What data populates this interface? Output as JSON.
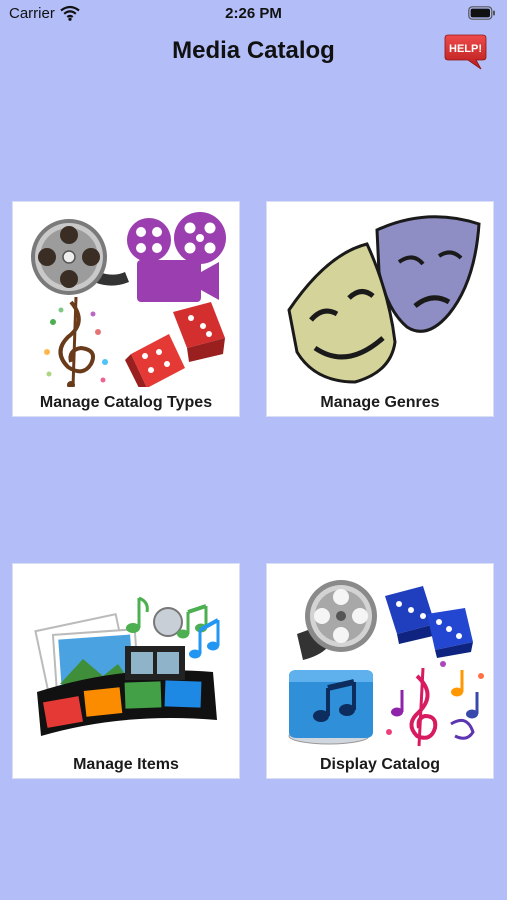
{
  "status_bar": {
    "carrier": "Carrier",
    "time": "2:26 PM"
  },
  "header": {
    "title": "Media Catalog",
    "help_label": "HELP!"
  },
  "tiles": [
    {
      "label": "Manage Catalog Types"
    },
    {
      "label": "Manage Genres"
    },
    {
      "label": "Manage Items"
    },
    {
      "label": "Display Catalog"
    }
  ],
  "colors": {
    "background": "#b3bef8",
    "tile": "#ffffff",
    "help": "#d42a2a"
  }
}
